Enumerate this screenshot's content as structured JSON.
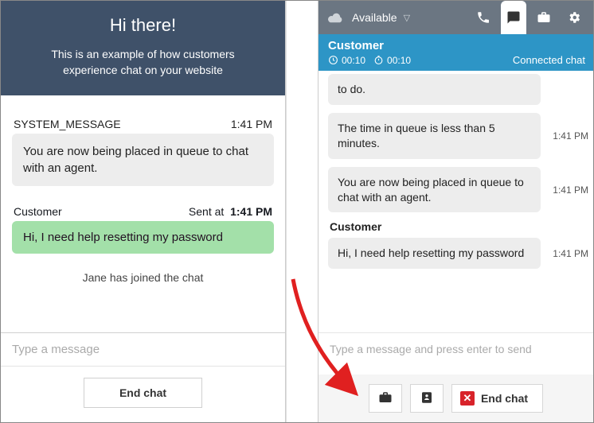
{
  "customer_widget": {
    "header_title": "Hi there!",
    "header_subtitle": "This is an example of how customers experience chat on your website",
    "system_label": "SYSTEM_MESSAGE",
    "system_time": "1:41 PM",
    "system_text": "You are now being placed in queue to chat with an agent.",
    "customer_label": "Customer",
    "customer_sent_label": "Sent at",
    "customer_time": "1:41 PM",
    "customer_text": "Hi, I need help resetting my password",
    "joined_text": "Jane has joined the chat",
    "input_placeholder": "Type a message",
    "end_chat_label": "End chat"
  },
  "agent_panel": {
    "availability": "Available",
    "customer_name": "Customer",
    "timer1": "00:10",
    "timer2": "00:10",
    "status_text": "Connected chat",
    "messages": [
      {
        "text": "to do.",
        "time": ""
      },
      {
        "text": "The time in queue is less than 5 minutes.",
        "time": "1:41 PM"
      },
      {
        "text": "You are now being placed in queue to chat with an agent.",
        "time": "1:41 PM"
      }
    ],
    "customer_sender": "Customer",
    "customer_msg": {
      "text": "Hi, I need help resetting my password",
      "time": "1:41 PM"
    },
    "input_placeholder": "Type a message and press enter to send",
    "end_chat_label": "End chat"
  }
}
